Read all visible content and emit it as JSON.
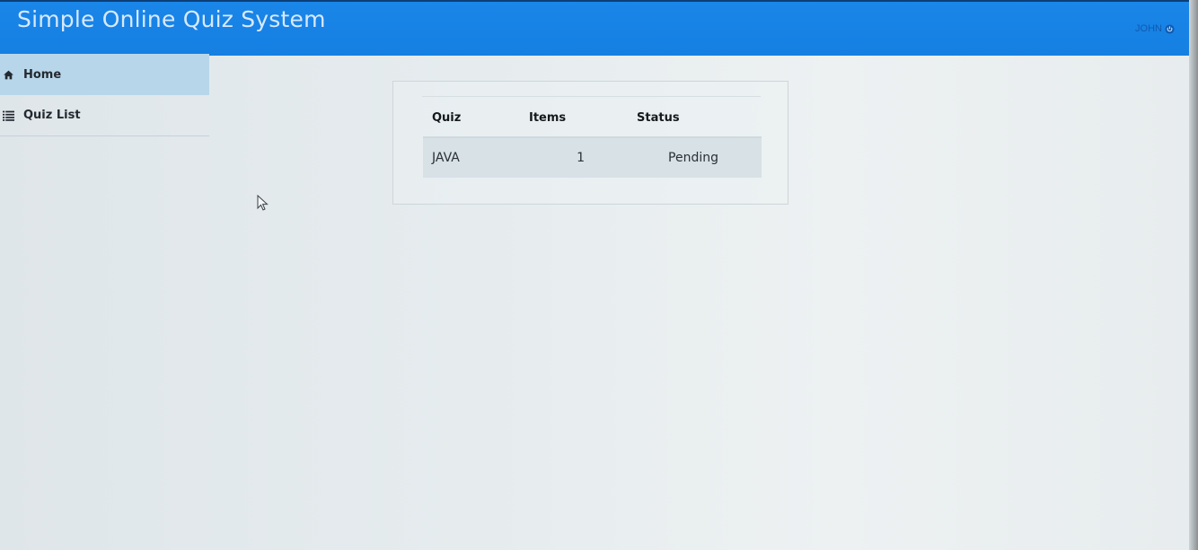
{
  "header": {
    "title": "Simple Online Quiz System",
    "user_name": "JOHN",
    "user_icon": "power-icon",
    "background_color": "#1a86e8"
  },
  "sidebar": {
    "items": [
      {
        "label": "Home",
        "icon": "home-icon",
        "active": true
      },
      {
        "label": "Quiz List",
        "icon": "list-icon",
        "active": false
      }
    ]
  },
  "table": {
    "columns": [
      "Quiz",
      "Items",
      "Status"
    ],
    "rows": [
      {
        "quiz": "JAVA",
        "items": "1",
        "status": "Pending"
      }
    ]
  }
}
